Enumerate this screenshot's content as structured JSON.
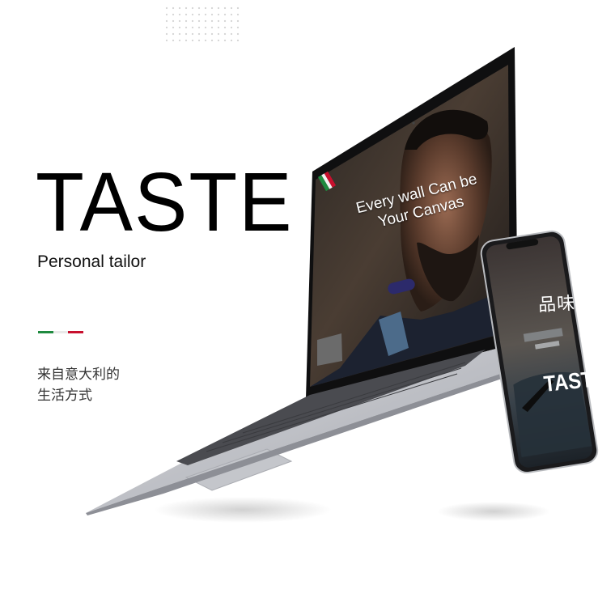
{
  "headline": "TASTE",
  "subtitle": "Personal tailor",
  "flag_colors": {
    "green": "#1f8a3f",
    "white": "#e9e9e9",
    "red": "#c8102e"
  },
  "chinese_lines": [
    "来自意大利的",
    "生活方式"
  ],
  "laptop": {
    "screen_headline_line1": "Every wall Can be",
    "screen_headline_line2": "Your Canvas"
  },
  "phone": {
    "title_cn": "品味",
    "title_en": "TASTE"
  },
  "icons": [
    "dot-grid-decoration",
    "italy-flag-icon",
    "laptop-mockup",
    "phone-mockup"
  ]
}
